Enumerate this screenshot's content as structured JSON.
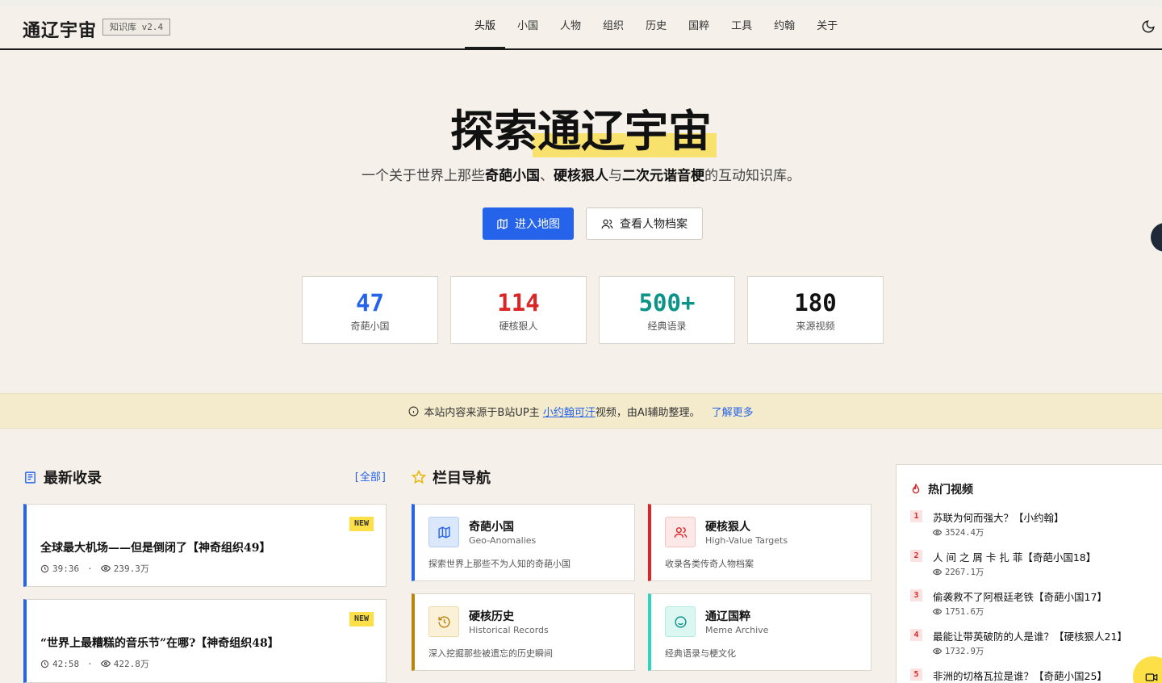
{
  "header": {
    "brand": "通辽宇宙",
    "version": "知识库 v2.4",
    "nav": [
      "头版",
      "小国",
      "人物",
      "组织",
      "历史",
      "国粹",
      "工具",
      "约翰",
      "关于"
    ],
    "active_nav": "头版",
    "theme_icon": "moon-icon"
  },
  "hero": {
    "title_plain": "探索",
    "title_highlight": "通辽宇宙",
    "subtitle_1": "一个关于世界上那些",
    "subtitle_b1": "奇葩小国",
    "subtitle_2": "、",
    "subtitle_b2": "硬核狠人",
    "subtitle_3": "与",
    "subtitle_b3": "二次元谐音梗",
    "subtitle_4": "的互动知识库。",
    "primary_button": "进入地图",
    "secondary_button": "查看人物档案"
  },
  "stats": [
    {
      "value": "47",
      "label": "奇葩小国",
      "color": "#2563eb"
    },
    {
      "value": "114",
      "label": "硬核狠人",
      "color": "#dc2626"
    },
    {
      "value": "500+",
      "label": "经典语录",
      "color": "#0d9488"
    },
    {
      "value": "180",
      "label": "来源视频",
      "color": "#111111"
    }
  ],
  "notice": {
    "text_1": "本站内容来源于B站UP主 ",
    "link": "小约翰可汗",
    "text_2": "视频，由AI辅助整理。",
    "more": "了解更多"
  },
  "latest": {
    "title": "最新收录",
    "view_all": "[全部]",
    "items": [
      {
        "badge": "NEW",
        "title": "全球最大机场——但是倒闭了【神奇组织49】",
        "duration": "39:36",
        "sep": "·",
        "views": "239.3万"
      },
      {
        "badge": "NEW",
        "title": "“世界上最糟糕的音乐节”在哪?【神奇组织48】",
        "duration": "42:58",
        "sep": "·",
        "views": "422.8万"
      }
    ]
  },
  "sections": {
    "title": "栏目导航",
    "cards": [
      {
        "title": "奇葩小国",
        "subtitle": "Geo-Anomalies",
        "desc": "探索世界上那些不为人知的奇葩小国",
        "icon": "map-icon",
        "color": "#2563eb"
      },
      {
        "title": "硬核狠人",
        "subtitle": "High-Value Targets",
        "desc": "收录各类传奇人物档案",
        "icon": "users-icon",
        "color": "#dc2626"
      },
      {
        "title": "硬核历史",
        "subtitle": "Historical Records",
        "desc": "深入挖掘那些被遗忘的历史瞬间",
        "icon": "history-icon",
        "color": "#b8860b"
      },
      {
        "title": "通辽国粹",
        "subtitle": "Meme Archive",
        "desc": "经典语录与梗文化",
        "icon": "smile-icon",
        "color": "#2dd4bf"
      }
    ]
  },
  "hot": {
    "title": "热门视频",
    "items": [
      {
        "rank": "1",
        "title": "苏联为何而强大？【小约翰】",
        "views": "3524.4万"
      },
      {
        "rank": "2",
        "title": "人 间 之 屑 卡 扎 菲【奇葩小国18】",
        "views": "2267.1万"
      },
      {
        "rank": "3",
        "title": "偷袭救不了阿根廷老铁【奇葩小国17】",
        "views": "1751.6万"
      },
      {
        "rank": "4",
        "title": "最能让带英破防的人是谁？【硬核狠人21】",
        "views": "1732.9万"
      },
      {
        "rank": "5",
        "title": "非洲的切格瓦拉是谁？【奇葩小国25】",
        "views": ""
      }
    ]
  }
}
